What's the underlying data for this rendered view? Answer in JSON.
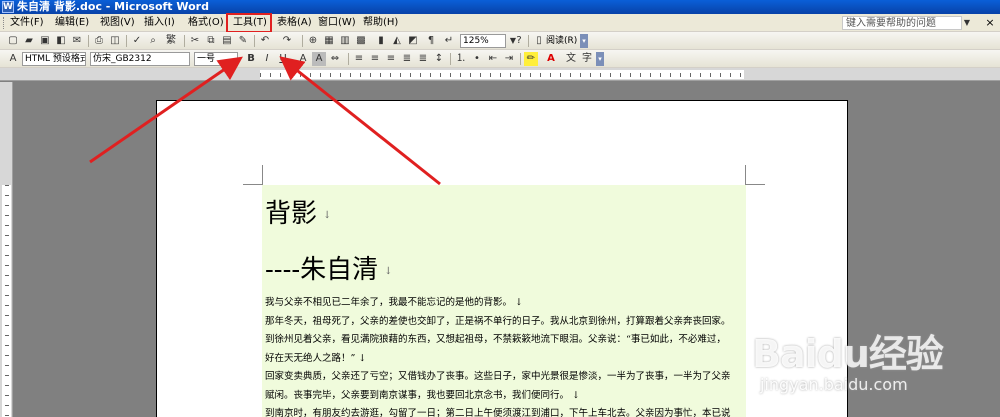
{
  "window": {
    "title": "朱自清 背影.doc - Microsoft Word",
    "icon_label": "W"
  },
  "menubar": {
    "items": [
      {
        "label": "文件(F)"
      },
      {
        "label": "编辑(E)"
      },
      {
        "label": "视图(V)"
      },
      {
        "label": "插入(I)"
      },
      {
        "label": "格式(O)"
      },
      {
        "label": "工具(T)"
      },
      {
        "label": "表格(A)"
      },
      {
        "label": "窗口(W)"
      },
      {
        "label": "帮助(H)"
      }
    ],
    "help_placeholder": "键入需要帮助的问题",
    "close_glyph": "×",
    "highlight_color": "#e02020"
  },
  "toolbar_standard": {
    "zoom": "125%",
    "read_label": "阅读(R)"
  },
  "toolbar_format": {
    "style_label": "HTML 预设格式",
    "font_name": "仿宋_GB2312",
    "font_size": "一号",
    "bold": "B",
    "italic": "I",
    "underline": "U",
    "char_a": "A",
    "char_a2": "A"
  },
  "document": {
    "title": "背影",
    "author_line": "----朱自清",
    "para_mark": "↓",
    "lines": [
      "我与父亲不相见已二年余了，我最不能忘记的是他的背影。 ↓",
      "那年冬天，祖母死了，父亲的差使也交卸了，正是祸不单行的日子。我从北京到徐州，打算跟着父亲奔丧回家。",
      "到徐州见着父亲，看见满院狼藉的东西，又想起祖母，不禁簌簌地流下眼泪。父亲说：“事已如此，不必难过，",
      "好在天无绝人之路！” ↓",
      "回家变卖典质，父亲还了亏空；又借钱办了丧事。这些日子，家中光景很是惨淡，一半为了丧事，一半为了父亲",
      "赋闲。丧事完毕，父亲要到南京谋事，我也要回北京念书，我们便同行。 ↓",
      "到南京时，有朋友约去游逛，勾留了一日；第二日上午便须渡江到浦口，下午上车北去。父亲因为事忙，本已说"
    ],
    "highlight_color": "#f0fbdc"
  },
  "annotation": {
    "arrow_color": "#e02020"
  },
  "watermark": {
    "logo": "Baidu经验",
    "url": "jingyan.baidu.com"
  }
}
